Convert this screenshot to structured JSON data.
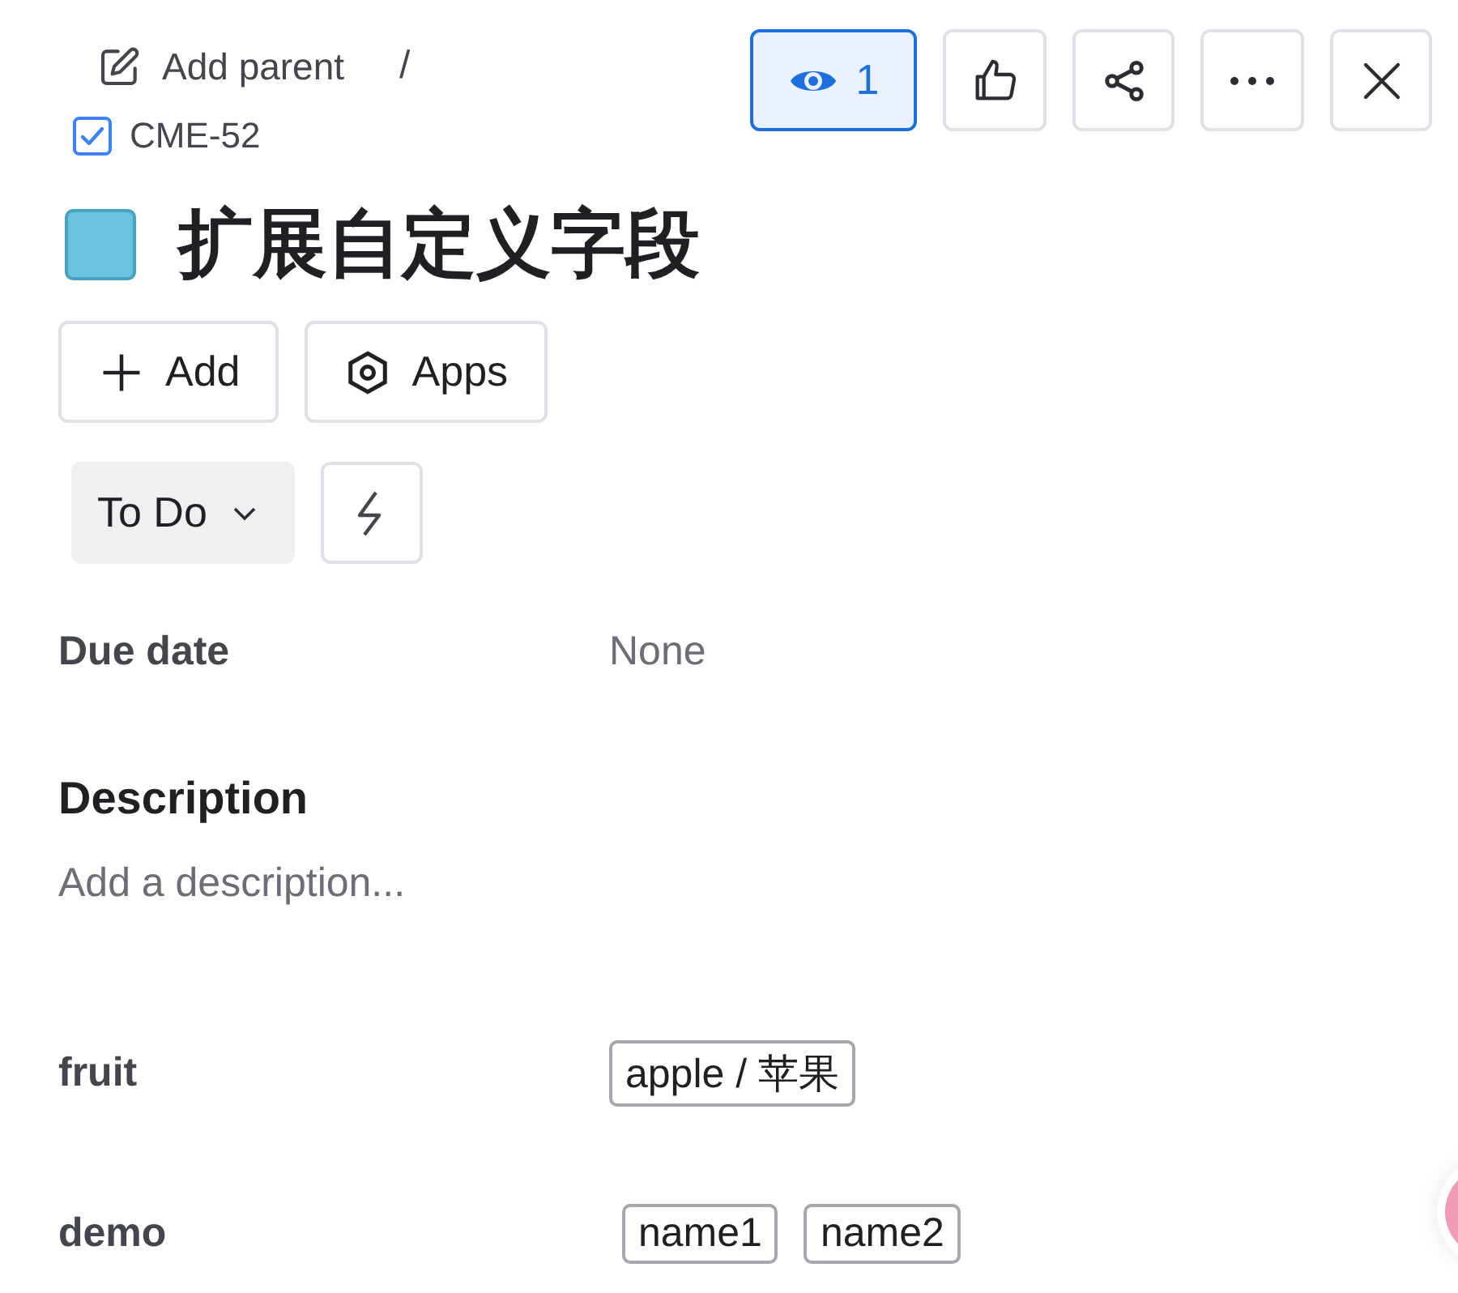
{
  "breadcrumb": {
    "parent_action": "Add parent",
    "separator": "/",
    "issue_key": "CME-52",
    "issue_checked": true
  },
  "actions": [
    {
      "kind": "watch",
      "label": "1",
      "selected": true
    },
    {
      "kind": "like",
      "selected": false
    },
    {
      "kind": "share",
      "selected": false
    },
    {
      "kind": "more",
      "selected": false
    },
    {
      "kind": "close",
      "selected": false
    }
  ],
  "title": "扩展自定义字段",
  "buttons": [
    {
      "kind": "add",
      "label": "Add"
    },
    {
      "kind": "apps",
      "label": "Apps"
    }
  ],
  "status": {
    "label": "To Do"
  },
  "due_date": {
    "label": "Due date",
    "value": "None"
  },
  "description": {
    "heading": "Description",
    "placeholder": "Add a description..."
  },
  "fields": [
    {
      "label": "fruit",
      "tags": [
        "apple / 苹果"
      ]
    },
    {
      "label": "demo",
      "tags": [
        "name1",
        "name2"
      ]
    }
  ]
}
